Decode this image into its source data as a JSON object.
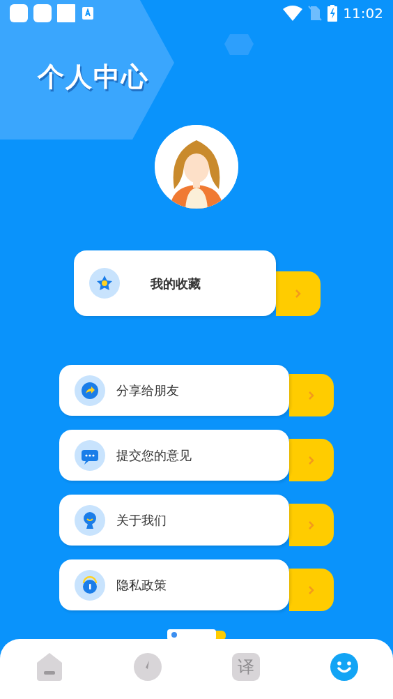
{
  "status_bar": {
    "time": "11:02"
  },
  "title": "个人中心",
  "favorite": {
    "label": "我的收藏"
  },
  "menu": [
    {
      "kind": "share",
      "label": "分享给朋友"
    },
    {
      "kind": "feedback",
      "label": "提交您的意见"
    },
    {
      "kind": "about",
      "label": "关于我们"
    },
    {
      "kind": "privacy",
      "label": "隐私政策"
    }
  ],
  "tabs": [
    {
      "kind": "home",
      "selected": false
    },
    {
      "kind": "compass",
      "selected": false
    },
    {
      "kind": "translate",
      "glyph": "译",
      "selected": false
    },
    {
      "kind": "profile",
      "selected": true
    }
  ]
}
